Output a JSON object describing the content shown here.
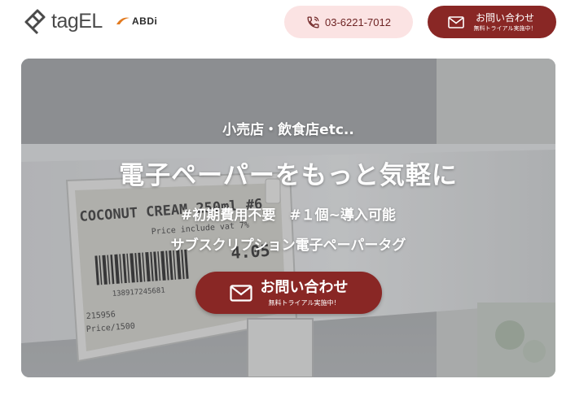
{
  "header": {
    "brand": "tagEL",
    "partner": "ABDi",
    "phone": "03-6221-7012",
    "contact": {
      "label": "お問い合わせ",
      "sublabel": "無料トライアル実施中！"
    }
  },
  "hero": {
    "subtitle": "小売店・飲食店etc..",
    "title": "電子ペーパーをもっと気軽に",
    "tags": "#初期費用不要　#１個~導入可能",
    "tagline": "サブスクリプション電子ペーパータグ",
    "cta": {
      "label": "お問い合わせ",
      "sublabel": "無料トライアル実施中！"
    },
    "tag_display": {
      "product": "COCONUT CREAM 250ml #6",
      "price_note": "Price include vat 7%",
      "price": "4.05",
      "barcode_number": "138917245681",
      "code": "215956",
      "unit_price": "Price/1500"
    }
  },
  "colors": {
    "brand_red": "#892725",
    "phone_bg": "#fbe3e3"
  }
}
